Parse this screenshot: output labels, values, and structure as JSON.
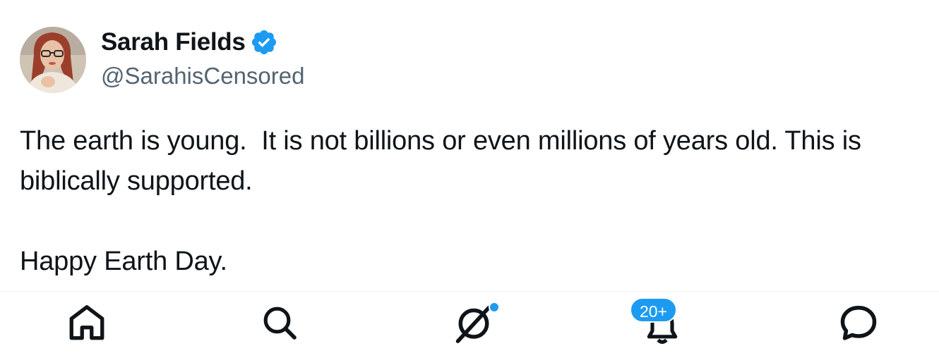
{
  "post": {
    "author": {
      "display_name": "Sarah Fields",
      "handle": "@SarahisCensored",
      "verified": true,
      "verified_color": "#1d9bf0"
    },
    "text": "The earth is young.  It is not billions or even millions of years old. This is biblically supported.\n\nHappy Earth Day."
  },
  "bottom_nav": {
    "items": [
      {
        "name": "home",
        "icon": "home-icon"
      },
      {
        "name": "search",
        "icon": "search-icon"
      },
      {
        "name": "grok",
        "icon": "grok-icon",
        "has_dot": true
      },
      {
        "name": "notifications",
        "icon": "bell-icon",
        "badge": "20+"
      },
      {
        "name": "messages",
        "icon": "message-icon"
      }
    ],
    "accent_color": "#1d9bf0"
  }
}
